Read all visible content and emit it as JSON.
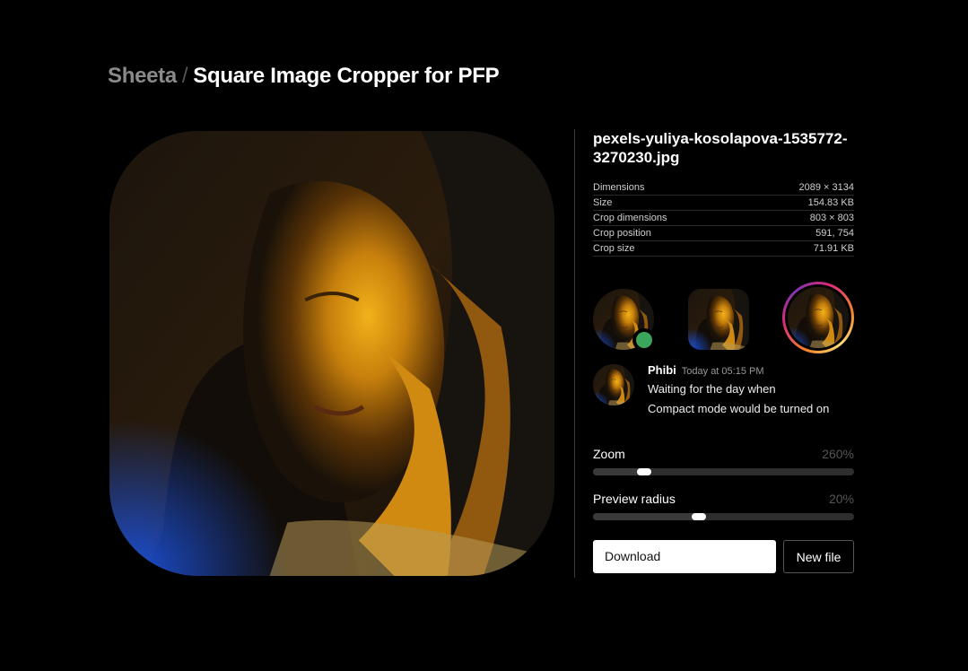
{
  "header": {
    "brand": "Sheeta",
    "separator": "/",
    "title": "Square Image Cropper for PFP"
  },
  "file": {
    "name": "pexels-yuliya-kosolapova-1535772-3270230.jpg"
  },
  "meta": [
    {
      "label": "Dimensions",
      "value": "2089 × 3134"
    },
    {
      "label": "Size",
      "value": "154.83 KB"
    },
    {
      "label": "Crop dimensions",
      "value": "803 × 803"
    },
    {
      "label": "Crop position",
      "value": "591, 754"
    },
    {
      "label": "Crop size",
      "value": "71.91 KB"
    }
  ],
  "chat": {
    "name": "Phibi",
    "time": "Today at 05:15 PM",
    "lines": [
      "Waiting for the day when",
      "Compact mode would be turned on"
    ]
  },
  "zoom": {
    "label": "Zoom",
    "value": "260%",
    "position": 0.195
  },
  "radius": {
    "label": "Preview radius",
    "value": "20%",
    "position": 0.405
  },
  "buttons": {
    "download": "Download",
    "new_file": "New file"
  },
  "colors": {
    "background": "#000000",
    "status_online": "#3ba55c",
    "accent_orange": "#f5a100",
    "accent_blue": "#1a4fd6"
  }
}
